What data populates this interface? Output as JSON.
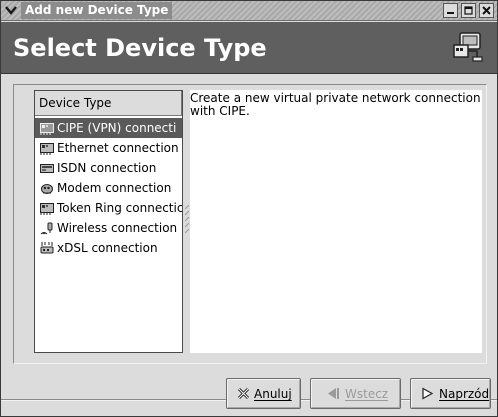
{
  "window": {
    "title": "Add new Device Type",
    "controls": [
      "minimize-icon",
      "maximize-icon",
      "close-icon"
    ]
  },
  "header": {
    "title": "Select Device Type",
    "icon": "network-device-icon"
  },
  "device_list": {
    "column_header": "Device Type",
    "selected_index": 0,
    "items": [
      {
        "label": "CIPE (VPN) connecti",
        "icon": "vpn-card-icon"
      },
      {
        "label": "Ethernet connection",
        "icon": "ethernet-card-icon"
      },
      {
        "label": "ISDN connection",
        "icon": "isdn-card-icon"
      },
      {
        "label": "Modem connection",
        "icon": "modem-icon"
      },
      {
        "label": "Token Ring connectic",
        "icon": "token-ring-card-icon"
      },
      {
        "label": "Wireless connection",
        "icon": "wireless-icon"
      },
      {
        "label": "xDSL connection",
        "icon": "xdsl-icon"
      }
    ]
  },
  "description": "Create a new virtual private network connection\nwith CIPE.",
  "buttons": {
    "cancel": {
      "label": "Anuluj",
      "icon": "cancel-x-icon",
      "enabled": true
    },
    "back": {
      "label": "Wstecz",
      "icon": "back-arrow-icon",
      "enabled": false
    },
    "next": {
      "label": "Naprzód",
      "icon": "forward-arrow-icon",
      "enabled": true
    }
  },
  "colors": {
    "header_bg": "#5f5f5f",
    "selection_bg": "#5a5a5a",
    "window_bg": "#dcdcdc"
  }
}
